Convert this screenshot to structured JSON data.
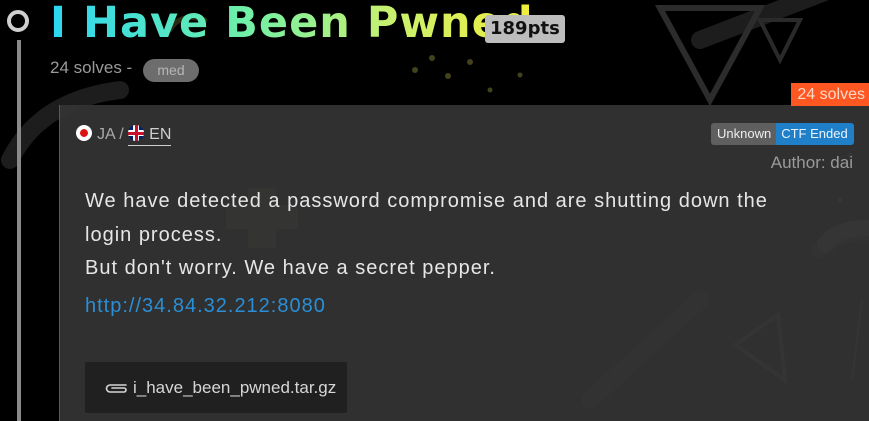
{
  "challenge": {
    "title": "I Have Been Pwned",
    "points": "189pts",
    "solves_text": "24 solves -",
    "difficulty": "med",
    "solves_badge": "24 solves"
  },
  "languages": {
    "ja": "JA",
    "separator": "/",
    "en": "EN"
  },
  "status": {
    "unknown": "Unknown",
    "state": "CTF Ended"
  },
  "author": "Author: dai",
  "description": {
    "line1": "We have detected a password compromise and are shutting down the",
    "line2": "login process.",
    "line3": "But don't worry. We have a secret pepper."
  },
  "link": "http://34.84.32.212:8080",
  "attachment": {
    "name": "i_have_been_pwned.tar.gz",
    "icon": "paperclip-icon"
  },
  "colors": {
    "accent_orange": "#ff5722",
    "status_blue": "#1f7fc9",
    "link_blue": "#2a8fd6"
  }
}
